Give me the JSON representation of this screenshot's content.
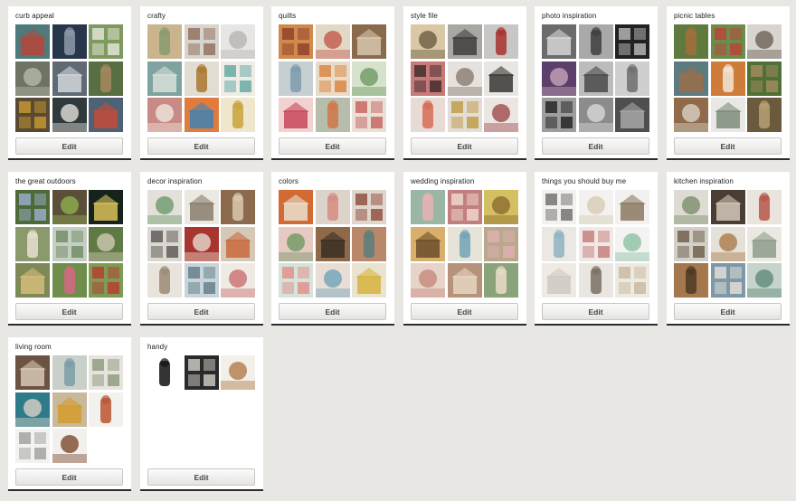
{
  "edit_label": "Edit",
  "boards": [
    {
      "title": "curb appeal",
      "thumbs": [
        {
          "name": "house-green-red-door-thumb",
          "bg": "#4f7a7b",
          "fg": "#b8443a"
        },
        {
          "name": "house-dark-blue-thumb",
          "bg": "#27364a",
          "fg": "#8e9aa8"
        },
        {
          "name": "house-white-porch-thumb",
          "bg": "#7e9a5d",
          "fg": "#e8e6e0"
        },
        {
          "name": "house-craftsman-thumb",
          "bg": "#6d7464",
          "fg": "#b6b9a8"
        },
        {
          "name": "house-gray-gable-thumb",
          "bg": "#5f6a75",
          "fg": "#d2d6da"
        },
        {
          "name": "house-green-lawn-thumb",
          "bg": "#587041",
          "fg": "#a7875f"
        },
        {
          "name": "door-yellow-thumb",
          "bg": "#5b4a33",
          "fg": "#c99a2e"
        },
        {
          "name": "house-black-trim-thumb",
          "bg": "#2e3a3e",
          "fg": "#e4e1d8"
        },
        {
          "name": "house-blue-porch-thumb",
          "bg": "#4d6275",
          "fg": "#c44b3a"
        }
      ]
    },
    {
      "title": "crafty",
      "thumbs": [
        {
          "name": "hexagon-quilt-thumb",
          "bg": "#c9b48e",
          "fg": "#8a9b6e"
        },
        {
          "name": "bedroom-craft-thumb",
          "bg": "#d8d3cd",
          "fg": "#8e6d5a"
        },
        {
          "name": "stamped-letters-thumb",
          "bg": "#e7e6e4",
          "fg": "#b6b5b3"
        },
        {
          "name": "teal-pattern-thumb",
          "bg": "#7fa4a0",
          "fg": "#d7dfd8"
        },
        {
          "name": "woman-scarf-thumb",
          "bg": "#e2ddd2",
          "fg": "#a8772e"
        },
        {
          "name": "paper-squares-thumb",
          "bg": "#efece6",
          "fg": "#5fa6a2"
        },
        {
          "name": "doily-pink-thumb",
          "bg": "#c98a85",
          "fg": "#efe7dc"
        },
        {
          "name": "fabric-scraps-thumb",
          "bg": "#e17c3d",
          "fg": "#3f83b3"
        },
        {
          "name": "yellow-scarf-thumb",
          "bg": "#efe6cc",
          "fg": "#c9a33b"
        }
      ]
    },
    {
      "title": "quilts",
      "thumbs": [
        {
          "name": "patchwork-quilt-thumb",
          "bg": "#d0894d",
          "fg": "#8f3f2a"
        },
        {
          "name": "quilt-bed-thumb",
          "bg": "#e3d8c6",
          "fg": "#c15a4a"
        },
        {
          "name": "quilt-room-thumb",
          "bg": "#8a6a4c",
          "fg": "#d6c6ae"
        },
        {
          "name": "quilt-gray-thumb",
          "bg": "#c6cfd2",
          "fg": "#7d9bad"
        },
        {
          "name": "quilt-orange-thumb",
          "bg": "#e8dcc8",
          "fg": "#d9823c"
        },
        {
          "name": "quilt-squares-thumb",
          "bg": "#d6e2cc",
          "fg": "#6e9b63"
        },
        {
          "name": "quilt-pink-thumb",
          "bg": "#f1d2d0",
          "fg": "#c9485b"
        },
        {
          "name": "quilt-stack-thumb",
          "bg": "#b7bdaa",
          "fg": "#d1774a"
        },
        {
          "name": "quilt-star-thumb",
          "bg": "#e9e1d6",
          "fg": "#c85f5f"
        }
      ]
    },
    {
      "title": "style file",
      "thumbs": [
        {
          "name": "woman-sunhat-thumb",
          "bg": "#d9c7a5",
          "fg": "#6d5b42"
        },
        {
          "name": "woman-walking-thumb",
          "bg": "#a8a7a3",
          "fg": "#3f3e3c"
        },
        {
          "name": "woman-red-coat-thumb",
          "bg": "#c9c7c5",
          "fg": "#a8312f"
        },
        {
          "name": "necklace-thumb",
          "bg": "#c67b7a",
          "fg": "#3b2a28"
        },
        {
          "name": "white-blouse-thumb",
          "bg": "#e6e1dc",
          "fg": "#8a7b70"
        },
        {
          "name": "woman-white-top-thumb",
          "bg": "#e8e6e3",
          "fg": "#3a3532"
        },
        {
          "name": "woman-coral-thumb",
          "bg": "#e8dad4",
          "fg": "#d66c57"
        },
        {
          "name": "woman-mustard-thumb",
          "bg": "#e2ddd6",
          "fg": "#c09a3f"
        },
        {
          "name": "woman-denim-thumb",
          "bg": "#ebe6e1",
          "fg": "#9d4b4b"
        }
      ]
    },
    {
      "title": "photo inspiration",
      "thumbs": [
        {
          "name": "bw-street-thumb",
          "bg": "#6b6b6b",
          "fg": "#d5d5d5"
        },
        {
          "name": "bw-cloud-thumb",
          "bg": "#a9a9a9",
          "fg": "#3e3e3e"
        },
        {
          "name": "bw-person-thumb",
          "bg": "#222222",
          "fg": "#bdbdbd"
        },
        {
          "name": "purple-portrait-thumb",
          "bg": "#5c3f6a",
          "fg": "#c7a4b8"
        },
        {
          "name": "bw-bridge-thumb",
          "bg": "#bcbcbc",
          "fg": "#4a4a4a"
        },
        {
          "name": "bw-skyline-thumb",
          "bg": "#cfcfcf",
          "fg": "#6d6d6d"
        },
        {
          "name": "bw-silhouette-thumb",
          "bg": "#9d9d9d",
          "fg": "#1f1f1f"
        },
        {
          "name": "bw-fog-thumb",
          "bg": "#8c8c8c",
          "fg": "#d8d8d8"
        },
        {
          "name": "bw-building-thumb",
          "bg": "#4f4f4f",
          "fg": "#a7a7a7"
        }
      ]
    },
    {
      "title": "picnic tables",
      "thumbs": [
        {
          "name": "garden-table-thumb",
          "bg": "#5e7a3f",
          "fg": "#a36f3c"
        },
        {
          "name": "red-table-thumb",
          "bg": "#6c8c4a",
          "fg": "#c0413a"
        },
        {
          "name": "patio-table-thumb",
          "bg": "#d8d5cf",
          "fg": "#6b6056"
        },
        {
          "name": "blue-table-thumb",
          "bg": "#5d7a80",
          "fg": "#9a6e4a"
        },
        {
          "name": "orange-bench-thumb",
          "bg": "#cf7c3a",
          "fg": "#f2e6d6"
        },
        {
          "name": "green-picnic-thumb",
          "bg": "#4f7138",
          "fg": "#a78b5c"
        },
        {
          "name": "wood-table-thumb",
          "bg": "#8f6b4b",
          "fg": "#dad2c4"
        },
        {
          "name": "white-table-thumb",
          "bg": "#e9e8e4",
          "fg": "#7e8c7a"
        },
        {
          "name": "rustic-table-thumb",
          "bg": "#6b5a3e",
          "fg": "#b79f73"
        }
      ]
    },
    {
      "title": "the great outdoors",
      "thumbs": [
        {
          "name": "forest-path-thumb",
          "bg": "#4f6a38",
          "fg": "#9ab0d0"
        },
        {
          "name": "fireplace-garden-thumb",
          "bg": "#5c4f3a",
          "fg": "#8eae4e"
        },
        {
          "name": "night-garden-thumb",
          "bg": "#16231a",
          "fg": "#d9c15a"
        },
        {
          "name": "porch-swing-thumb",
          "bg": "#8a9a6c",
          "fg": "#e6dfcf"
        },
        {
          "name": "white-pergola-thumb",
          "bg": "#c4cfc2",
          "fg": "#6f8a63"
        },
        {
          "name": "arbor-thumb",
          "bg": "#5f7a43",
          "fg": "#d0c9b3"
        },
        {
          "name": "cottage-garden-thumb",
          "bg": "#7d8a56",
          "fg": "#d6bb7c"
        },
        {
          "name": "pink-garden-thumb",
          "bg": "#6f8e4c",
          "fg": "#d36a84"
        },
        {
          "name": "red-bathtub-thumb",
          "bg": "#7f9a55",
          "fg": "#b93a2d"
        }
      ]
    },
    {
      "title": "decor inspiration",
      "thumbs": [
        {
          "name": "shelf-display-thumb",
          "bg": "#e3e0da",
          "fg": "#6b9a6a"
        },
        {
          "name": "white-kitchen-thumb",
          "bg": "#ece9e3",
          "fg": "#8a7d6c"
        },
        {
          "name": "rustic-room-thumb",
          "bg": "#8c6a4e",
          "fg": "#d9c9ae"
        },
        {
          "name": "iron-bed-thumb",
          "bg": "#dcd8d1",
          "fg": "#585552"
        },
        {
          "name": "red-wall-thumb",
          "bg": "#a8362f",
          "fg": "#e6dcd0"
        },
        {
          "name": "colorful-shelves-thumb",
          "bg": "#d6c8b6",
          "fg": "#c96a3e"
        },
        {
          "name": "gallery-wall-thumb",
          "bg": "#e8e4dc",
          "fg": "#9a8b76"
        },
        {
          "name": "blue-room-thumb",
          "bg": "#c9d4d8",
          "fg": "#5f7b88"
        },
        {
          "name": "bright-bedroom-thumb",
          "bg": "#efebe4",
          "fg": "#c96f6f"
        }
      ]
    },
    {
      "title": "colors",
      "thumbs": [
        {
          "name": "orange-curtain-thumb",
          "bg": "#d46a33",
          "fg": "#e9dfcf"
        },
        {
          "name": "palette-dress-thumb",
          "bg": "#dcd3cb",
          "fg": "#d68c83"
        },
        {
          "name": "fashion-palette-thumb",
          "bg": "#e0d7cc",
          "fg": "#8c4a3a"
        },
        {
          "name": "floral-palette-thumb",
          "bg": "#e7c9c4",
          "fg": "#6f9a63"
        },
        {
          "name": "brown-coat-thumb",
          "bg": "#8e6a48",
          "fg": "#3b2e25"
        },
        {
          "name": "rust-colors-thumb",
          "bg": "#b9876a",
          "fg": "#5a7f7a"
        },
        {
          "name": "mint-palette-thumb",
          "bg": "#d5e3da",
          "fg": "#e38c87"
        },
        {
          "name": "pastel-party-thumb",
          "bg": "#e9ded5",
          "fg": "#6ea2b8"
        },
        {
          "name": "yellow-palette-thumb",
          "bg": "#eae3cf",
          "fg": "#d6b43f"
        }
      ]
    },
    {
      "title": "wedding inspiration",
      "thumbs": [
        {
          "name": "pink-flowers-thumb",
          "bg": "#9ab7a5",
          "fg": "#e9b2b4"
        },
        {
          "name": "pink-cake-thumb",
          "bg": "#c17f7f",
          "fg": "#f0dcd2"
        },
        {
          "name": "yellow-pinata-thumb",
          "bg": "#d4c063",
          "fg": "#8d6a2e"
        },
        {
          "name": "gold-decor-thumb",
          "bg": "#d9b06b",
          "fg": "#6b4e2a"
        },
        {
          "name": "invitation-thumb",
          "bg": "#e6e3d9",
          "fg": "#6fa3b6"
        },
        {
          "name": "flower-bouquet-thumb",
          "bg": "#b9a88c",
          "fg": "#e2b0b3"
        },
        {
          "name": "cupcakes-thumb",
          "bg": "#e7d3c8",
          "fg": "#c58a7d"
        },
        {
          "name": "reception-table-thumb",
          "bg": "#b7927a",
          "fg": "#e6d6c2"
        },
        {
          "name": "outdoor-wedding-thumb",
          "bg": "#8aa37a",
          "fg": "#e9dcc9"
        }
      ]
    },
    {
      "title": "things you should buy me",
      "thumbs": [
        {
          "name": "knit-pouf-thumb",
          "bg": "#f2f1ef",
          "fg": "#6e6a66"
        },
        {
          "name": "ceramic-figure-thumb",
          "bg": "#f3f2f0",
          "fg": "#d8cbb4"
        },
        {
          "name": "table-lamp-thumb",
          "bg": "#f2f1ef",
          "fg": "#8b7960"
        },
        {
          "name": "blue-jug-thumb",
          "bg": "#ebe8e4",
          "fg": "#8fb3c2"
        },
        {
          "name": "floral-dress-thumb",
          "bg": "#f0eae6",
          "fg": "#c47b7b"
        },
        {
          "name": "cake-stand-thumb",
          "bg": "#f3f3f1",
          "fg": "#8cc0a4"
        },
        {
          "name": "marquee-letter-thumb",
          "bg": "#eeebe7",
          "fg": "#cfc9c1"
        },
        {
          "name": "coat-hooks-thumb",
          "bg": "#e9e6e2",
          "fg": "#7b6f64"
        },
        {
          "name": "curtain-thumb",
          "bg": "#ede9e3",
          "fg": "#c8b79c"
        }
      ]
    },
    {
      "title": "kitchen inspiration",
      "thumbs": [
        {
          "name": "white-kitchen-shelves-thumb",
          "bg": "#dedbd4",
          "fg": "#7a8d6b"
        },
        {
          "name": "dark-kitchen-thumb",
          "bg": "#4a3e34",
          "fg": "#d2c8b8"
        },
        {
          "name": "open-shelf-kitchen-thumb",
          "bg": "#e9e4dc",
          "fg": "#b9554a"
        },
        {
          "name": "kitchen-island-thumb",
          "bg": "#d3cfc7",
          "fg": "#6a5a48"
        },
        {
          "name": "bright-kitchen-thumb",
          "bg": "#e6e1d8",
          "fg": "#a97a4a"
        },
        {
          "name": "farmhouse-kitchen-thumb",
          "bg": "#ebe8e2",
          "fg": "#8e9c8a"
        },
        {
          "name": "wood-drawers-thumb",
          "bg": "#a5774d",
          "fg": "#4d3824"
        },
        {
          "name": "blue-cabinets-thumb",
          "bg": "#7d98a6",
          "fg": "#e7e2d9"
        },
        {
          "name": "green-kitchen-thumb",
          "bg": "#c6d4cb",
          "fg": "#5e8a78"
        }
      ]
    },
    {
      "title": "living room",
      "thumbs": [
        {
          "name": "fireplace-living-thumb",
          "bg": "#6b5444",
          "fg": "#d6c8b3"
        },
        {
          "name": "coastal-living-thumb",
          "bg": "#c9cfc9",
          "fg": "#7a9da8"
        },
        {
          "name": "white-living-thumb",
          "bg": "#e6e3dd",
          "fg": "#8a9a7a"
        },
        {
          "name": "teal-sofa-thumb",
          "bg": "#2f7b8a",
          "fg": "#d9d2c4"
        },
        {
          "name": "mustard-chair-thumb",
          "bg": "#c9b99c",
          "fg": "#d59b2e"
        },
        {
          "name": "orange-armchair-thumb",
          "bg": "#f3f1ee",
          "fg": "#b8552e"
        },
        {
          "name": "gray-sofa-thumb",
          "bg": "#f3f2f0",
          "fg": "#9d9d9d"
        },
        {
          "name": "leather-sofa-thumb",
          "bg": "#f2f0ed",
          "fg": "#7a4a2e"
        }
      ]
    },
    {
      "title": "handy",
      "thumbs": [
        {
          "name": "hand-gloves-thumb",
          "bg": "#ffffff",
          "fg": "#111111"
        },
        {
          "name": "stain-chart-thumb",
          "bg": "#2a2a2a",
          "fg": "#d4cfc8"
        },
        {
          "name": "hairstyle-chart-thumb",
          "bg": "#f3efe9",
          "fg": "#b07a4a"
        }
      ]
    }
  ]
}
